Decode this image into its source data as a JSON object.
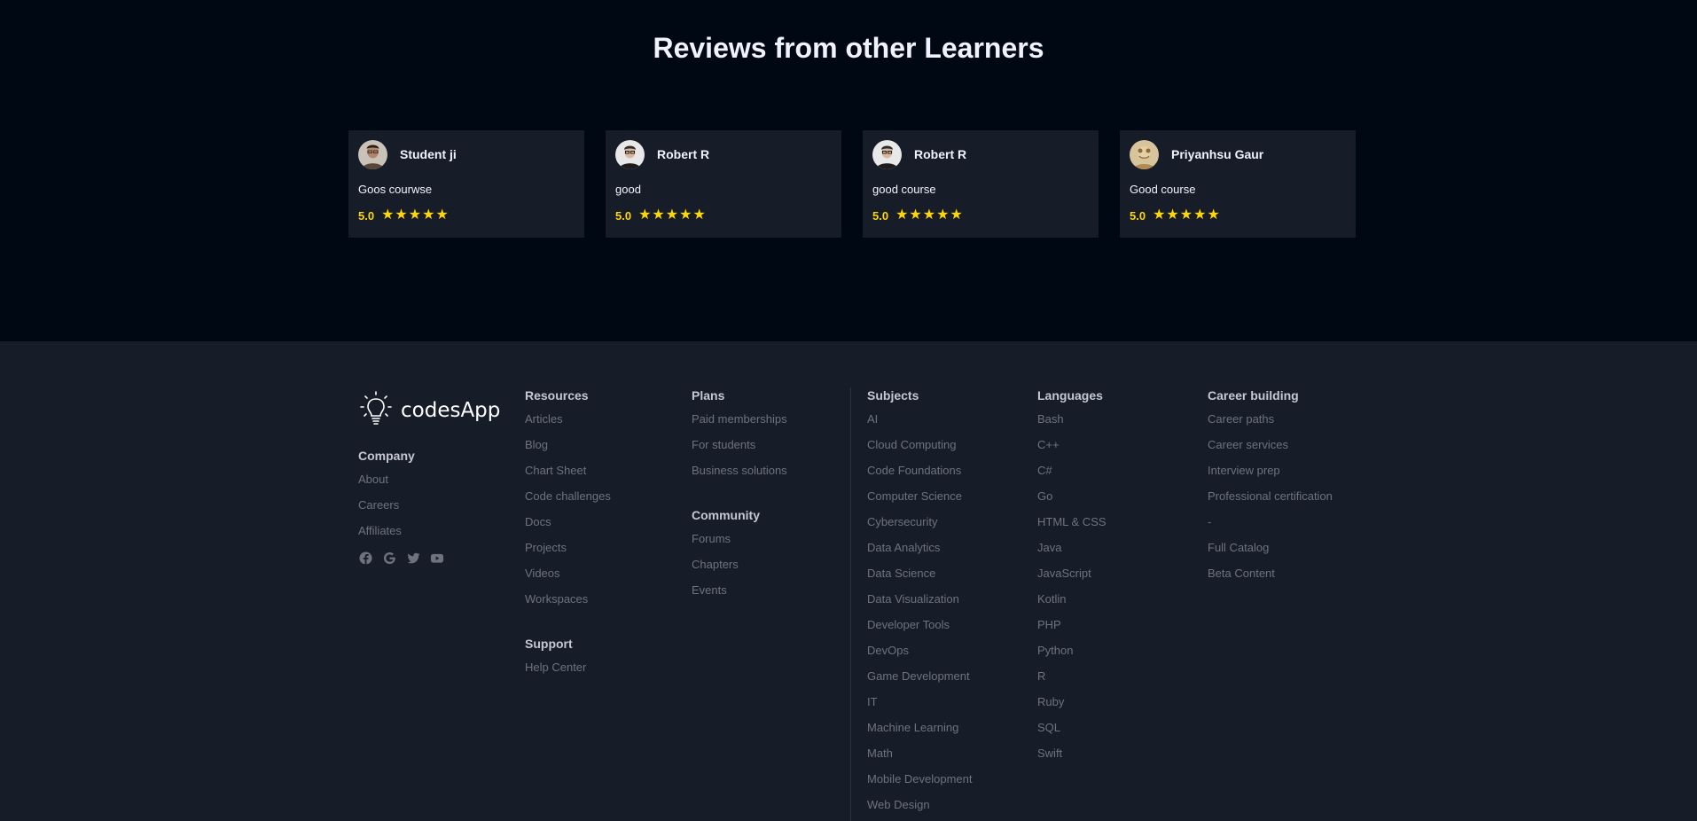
{
  "reviews": {
    "title": "Reviews from other Learners",
    "cards": [
      {
        "name": "Student ji",
        "text": "Goos courwse",
        "rating": "5.0",
        "stars": 5
      },
      {
        "name": "Robert R",
        "text": "good",
        "rating": "5.0",
        "stars": 5
      },
      {
        "name": "Robert R",
        "text": "good course",
        "rating": "5.0",
        "stars": 5
      },
      {
        "name": "Priyanhsu Gaur",
        "text": "Good course",
        "rating": "5.0",
        "stars": 5
      }
    ],
    "star_glyph": "★",
    "star_color": "#ffd60a"
  },
  "footer": {
    "logo_text": "codesApp",
    "company": {
      "heading": "Company",
      "links": [
        "About",
        "Careers",
        "Affiliates"
      ],
      "socials": [
        "facebook-icon",
        "google-icon",
        "twitter-icon",
        "youtube-icon"
      ]
    },
    "resources": {
      "heading": "Resources",
      "links": [
        "Articles",
        "Blog",
        "Chart Sheet",
        "Code challenges",
        "Docs",
        "Projects",
        "Videos",
        "Workspaces"
      ]
    },
    "support": {
      "heading": "Support",
      "links": [
        "Help Center"
      ]
    },
    "plans": {
      "heading": "Plans",
      "links": [
        "Paid memberships",
        "For students",
        "Business solutions"
      ]
    },
    "community": {
      "heading": "Community",
      "links": [
        "Forums",
        "Chapters",
        "Events"
      ]
    },
    "subjects": {
      "heading": "Subjects",
      "links": [
        "AI",
        "Cloud Computing",
        "Code Foundations",
        "Computer Science",
        "Cybersecurity",
        "Data Analytics",
        "Data Science",
        "Data Visualization",
        "Developer Tools",
        "DevOps",
        "Game Development",
        "IT",
        "Machine Learning",
        "Math",
        "Mobile Development",
        "Web Design"
      ]
    },
    "languages": {
      "heading": "Languages",
      "links": [
        "Bash",
        "C++",
        "C#",
        "Go",
        "HTML & CSS",
        "Java",
        "JavaScript",
        "Kotlin",
        "PHP",
        "Python",
        "R",
        "Ruby",
        "SQL",
        "Swift"
      ]
    },
    "career": {
      "heading": "Career building",
      "links": [
        "Career paths",
        "Career services",
        "Interview prep",
        "Professional certification",
        "-",
        "Full Catalog",
        "Beta Content"
      ]
    }
  }
}
